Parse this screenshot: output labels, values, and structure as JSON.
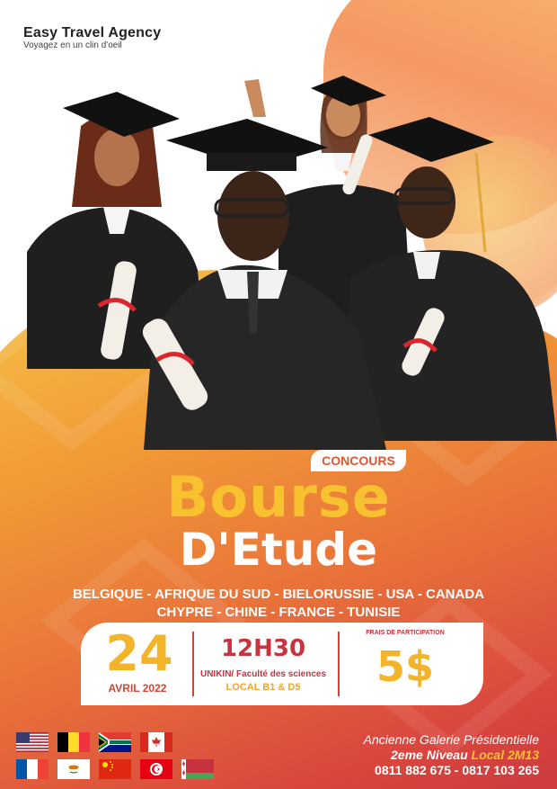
{
  "brand": {
    "name": "Easy Travel Agency",
    "tagline": "Voyagez en un clin d'oeil"
  },
  "badge": "CONCOURS",
  "title": {
    "line1": "Bourse",
    "line2": "D'Etude"
  },
  "countries": {
    "line1": "BELGIQUE - AFRIQUE DU SUD - BIELORUSSIE - USA - CANADA",
    "line2": "CHYPRE - CHINE - FRANCE - TUNISIE"
  },
  "info": {
    "day": "24",
    "month_year": "AVRIL 2022",
    "time": "12H30",
    "venue": "UNIKIN/ Faculté des sciences",
    "room": "LOCAL B1 & D5",
    "fee_label": "FRAIS DE PARTICIPATION",
    "fee": "5$"
  },
  "address": {
    "line1": "Ancienne Galerie Présidentielle",
    "line2_a": "2eme Niveau ",
    "line2_b": "Local 2M13",
    "phones": "0811 882 675 - 0817 103 265"
  },
  "flags": [
    "usa-flag",
    "belgium-flag",
    "south-africa-flag",
    "canada-flag",
    "france-flag",
    "cyprus-flag",
    "china-flag",
    "tunisia-flag",
    "belarus-flag"
  ],
  "colors": {
    "accent_yellow": "#f8c12f",
    "accent_red": "#c8333e",
    "accent_orange": "#e0572f"
  }
}
